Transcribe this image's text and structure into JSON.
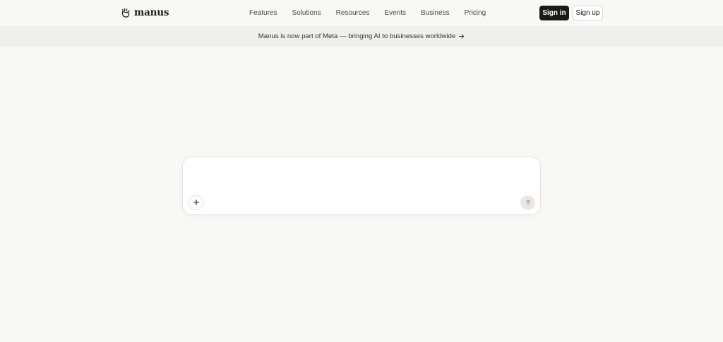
{
  "header": {
    "brand": "manus",
    "nav": [
      "Features",
      "Solutions",
      "Resources",
      "Events",
      "Business",
      "Pricing"
    ],
    "signin_label": "Sign in",
    "signup_label": "Sign up"
  },
  "banner": {
    "text": "Manus is now part of Meta — bringing AI to businesses worldwide",
    "icon": "arrow-right-icon"
  },
  "composer": {
    "placeholder": "",
    "add_icon": "plus-icon",
    "send_icon": "arrow-up-icon"
  },
  "colors": {
    "background": "#f8f8f7",
    "banner_background": "#efefed",
    "primary_button": "#1a1a19",
    "text": "#34322d"
  }
}
